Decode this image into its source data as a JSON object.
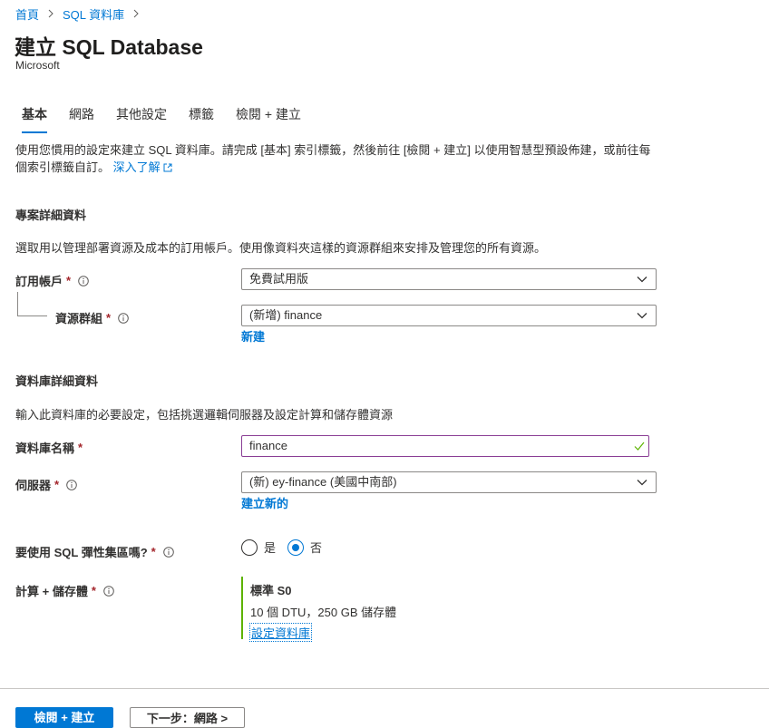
{
  "breadcrumb": {
    "home": "首頁",
    "current": "SQL 資料庫"
  },
  "page": {
    "title": "建立 SQL Database",
    "publisher": "Microsoft"
  },
  "tabs": [
    {
      "label": "基本",
      "active": true
    },
    {
      "label": "網路",
      "active": false
    },
    {
      "label": "其他設定",
      "active": false
    },
    {
      "label": "標籤",
      "active": false
    },
    {
      "label": "檢閱 + 建立",
      "active": false
    }
  ],
  "intro": {
    "text": "使用您慣用的設定來建立 SQL 資料庫。請完成 [基本] 索引標籤，然後前往 [檢閱 + 建立] 以使用智慧型預設佈建，或前往每個索引標籤自訂。",
    "learn_more": "深入了解"
  },
  "project_details": {
    "title": "專案詳細資料",
    "description": "選取用以管理部署資源及成本的訂用帳戶。使用像資料夾這樣的資源群組來安排及管理您的所有資源。",
    "subscription": {
      "label": "訂用帳戶",
      "required_mark": "*",
      "value": "免費試用版"
    },
    "resource_group": {
      "label": "資源群組",
      "required_mark": "*",
      "value": "(新增) finance",
      "create_link": "新建"
    }
  },
  "database_details": {
    "title": "資料庫詳細資料",
    "description": "輸入此資料庫的必要設定，包括挑選邏輯伺服器及設定計算和儲存體資源",
    "db_name": {
      "label": "資料庫名稱",
      "required_mark": "*",
      "value": "finance"
    },
    "server": {
      "label": "伺服器",
      "required_mark": "*",
      "value": "(新) ey-finance (美國中南部)",
      "create_link": "建立新的"
    },
    "elastic_pool": {
      "label": "要使用 SQL 彈性集區嗎?",
      "required_mark": "*",
      "option_yes": "是",
      "option_no": "否",
      "selected": "否"
    },
    "compute": {
      "label": "計算 + 儲存體",
      "required_mark": "*",
      "tier": "標準 S0",
      "detail": "10 個 DTU，250 GB 儲存體",
      "configure_link": "設定資料庫"
    }
  },
  "footer": {
    "primary_button": "檢閱 + 建立",
    "next_button": "下一步：網路 >"
  },
  "colors": {
    "accent": "#0078d4",
    "valid": "#5db300",
    "required": "#a4262c",
    "focus_border": "#8a3e95"
  },
  "icons": {
    "info": "info-icon",
    "chevron": "chevron-down-icon",
    "check": "checkmark-icon",
    "external": "external-link-icon",
    "breadcrumb_sep": "chevron-right-icon"
  }
}
